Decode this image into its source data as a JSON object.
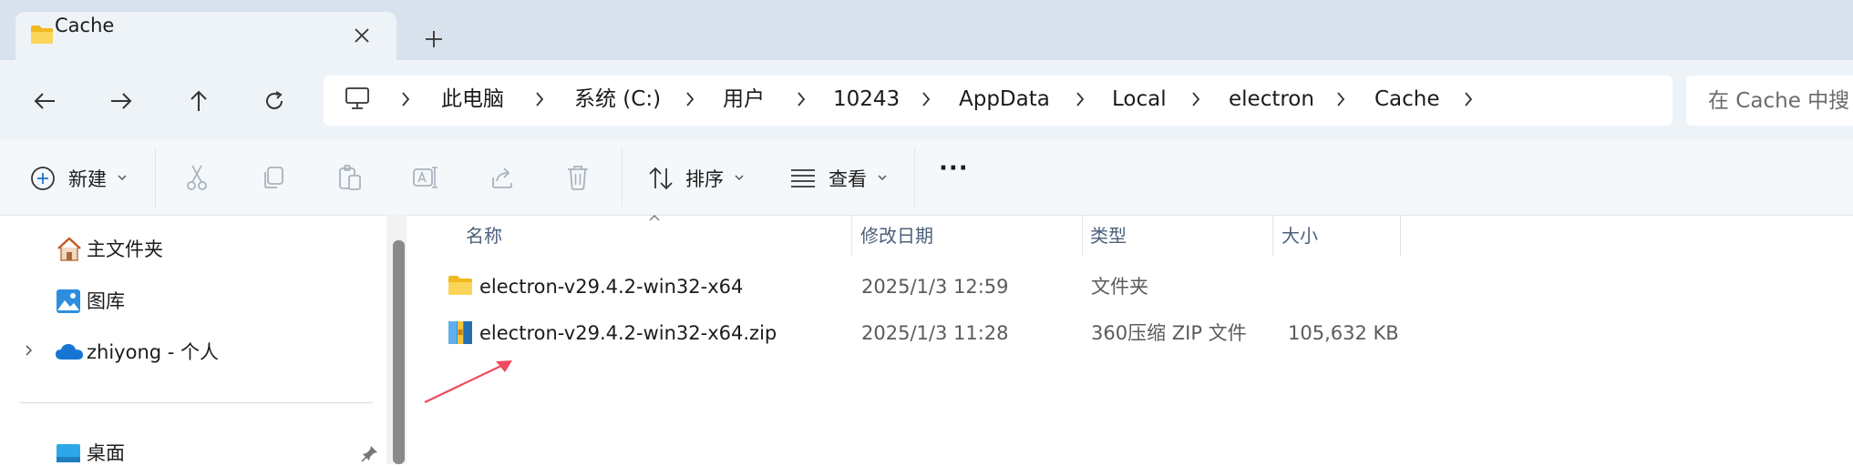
{
  "window": {
    "tab": {
      "title": "Cache",
      "close_icon": "close-icon",
      "icon": "folder-icon"
    },
    "new_tab_icon": "plus-icon"
  },
  "nav": {
    "back_icon": "arrow-left-icon",
    "forward_icon": "arrow-right-icon",
    "up_icon": "arrow-up-icon",
    "refresh_icon": "refresh-icon",
    "breadcrumb": [
      "此电脑",
      "系统 (C:)",
      "用户",
      "10243",
      "AppData",
      "Local",
      "electron",
      "Cache"
    ],
    "search_placeholder": "在 Cache 中搜"
  },
  "toolbar": {
    "new_label": "新建",
    "sort_label": "排序",
    "view_label": "查看",
    "more_label": "···",
    "icons": [
      "cut-icon",
      "copy-icon",
      "paste-icon",
      "rename-icon",
      "share-icon",
      "delete-icon"
    ]
  },
  "sidebar": {
    "items": [
      {
        "label": "主文件夹",
        "icon": "home-icon"
      },
      {
        "label": "图库",
        "icon": "gallery-icon"
      },
      {
        "label": "zhiyong - 个人",
        "icon": "onedrive-icon"
      },
      {
        "label": "桌面",
        "icon": "desktop-icon"
      }
    ]
  },
  "table": {
    "columns": [
      "名称",
      "修改日期",
      "类型",
      "大小"
    ],
    "rows": [
      {
        "name": "electron-v29.4.2-win32-x64",
        "modified": "2025/1/3 12:59",
        "type": "文件夹",
        "size": "",
        "icon": "folder-icon"
      },
      {
        "name": "electron-v29.4.2-win32-x64.zip",
        "modified": "2025/1/3 11:28",
        "type": "360压缩 ZIP 文件",
        "size": "105,632 KB",
        "icon": "zip-archive-icon"
      }
    ]
  },
  "colors": {
    "accent": "#ee4b5d",
    "folder": "#f7c948",
    "tab_strip": "#d8e2ec",
    "nav_bar": "#eef3f8"
  }
}
